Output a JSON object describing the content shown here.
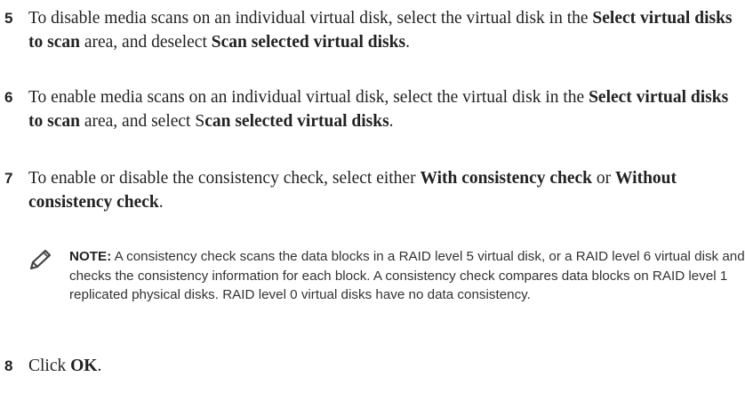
{
  "steps": [
    {
      "number": "5",
      "parts": [
        {
          "t": "To disable media scans on an individual virtual disk, select the virtual disk in the ",
          "b": false
        },
        {
          "t": "Select virtual disks to scan",
          "b": true
        },
        {
          "t": " area, and deselect ",
          "b": false
        },
        {
          "t": "Scan selected virtual disks",
          "b": true
        },
        {
          "t": ".",
          "b": false
        }
      ]
    },
    {
      "number": "6",
      "parts": [
        {
          "t": "To enable media scans on an individual virtual disk, select the virtual disk in the ",
          "b": false
        },
        {
          "t": "Select virtual disks to scan",
          "b": true
        },
        {
          "t": " area, and select S",
          "b": false
        },
        {
          "t": "can selected virtual disks",
          "b": true
        },
        {
          "t": ".",
          "b": false
        }
      ]
    },
    {
      "number": "7",
      "parts": [
        {
          "t": "To enable or disable the consistency check, select either ",
          "b": false
        },
        {
          "t": "With consistency check",
          "b": true
        },
        {
          "t": " or ",
          "b": false
        },
        {
          "t": "Without consistency check",
          "b": true
        },
        {
          "t": ".",
          "b": false
        }
      ]
    },
    {
      "number": "8",
      "parts": [
        {
          "t": "Click ",
          "b": false
        },
        {
          "t": "OK",
          "b": true
        },
        {
          "t": ".",
          "b": false
        }
      ]
    }
  ],
  "note": {
    "icon": "pencil-note-icon",
    "label": "NOTE:",
    "text": " A consistency check scans the data blocks in a RAID level 5 virtual disk, or a RAID level 6 virtual disk and checks the consistency information for each block. A consistency check compares data blocks on RAID level 1 replicated physical disks. RAID level 0 virtual disks have no data consistency."
  }
}
